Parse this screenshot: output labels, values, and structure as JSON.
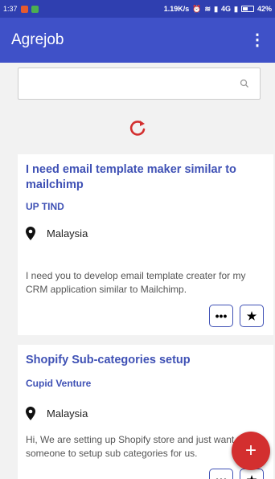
{
  "status_bar": {
    "time": "1:37",
    "speed": "1.19K/s",
    "network": "4G",
    "battery": "42%"
  },
  "app_bar": {
    "title": "Agrejob",
    "overflow": "⋮"
  },
  "search": {
    "placeholder": ""
  },
  "jobs": [
    {
      "title": "I need email template maker similar to mailchimp",
      "company": "UP TIND",
      "location": "Malaysia",
      "description": "I need you to develop email template creater for my CRM application similar to Mailchimp.",
      "more_label": "•••",
      "star_label": "★"
    },
    {
      "title": "Shopify Sub-categories setup",
      "company": "Cupid Venture",
      "location": "Malaysia",
      "description": "Hi, We are setting up Shopify store and just want someone to setup sub categories for us.",
      "more_label": "•••",
      "star_label": "★"
    }
  ],
  "fab": {
    "label": "+"
  },
  "colors": {
    "primary": "#3f51c8",
    "accent": "#d32f2f",
    "status": "#2f3fb0"
  }
}
